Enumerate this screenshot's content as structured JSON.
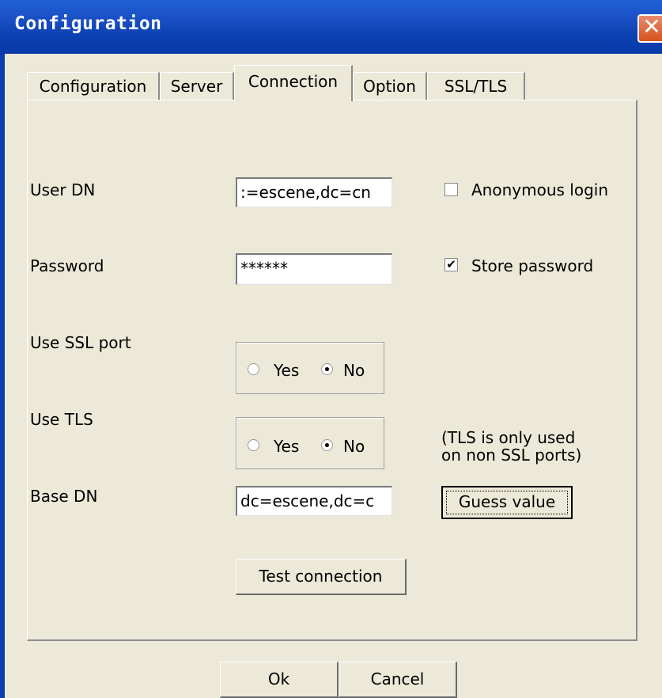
{
  "window": {
    "title": "Configuration",
    "close_glyph": "✕"
  },
  "tabs": [
    {
      "label": "Configuration"
    },
    {
      "label": "Server"
    },
    {
      "label": "Connection"
    },
    {
      "label": "Option"
    },
    {
      "label": "SSL/TLS"
    }
  ],
  "active_tab": "Connection",
  "form": {
    "user_dn_label": "User DN",
    "user_dn_value": ":=escene,dc=cn",
    "anonymous_label": "Anonymous login",
    "anonymous_checked": false,
    "password_label": "Password",
    "password_value": "******",
    "store_password_label": "Store password",
    "store_password_checked": true,
    "store_password_mark": "✔",
    "ssl_label": "Use SSL port",
    "ssl_yes": "Yes",
    "ssl_no": "No",
    "ssl_selected": "No",
    "tls_label": "Use TLS",
    "tls_yes": "Yes",
    "tls_no": "No",
    "tls_selected": "No",
    "tls_note_line1": "(TLS is only used",
    "tls_note_line2": "on non SSL ports)",
    "base_dn_label": "Base DN",
    "base_dn_value": "dc=escene,dc=c",
    "guess_button": "Guess value",
    "test_button": "Test connection"
  },
  "footer": {
    "ok": "Ok",
    "cancel": "Cancel"
  },
  "colors": {
    "title_bar": "#0b3fb0",
    "dialog_bg": "#ece9d8",
    "close_button": "#d6521f"
  }
}
